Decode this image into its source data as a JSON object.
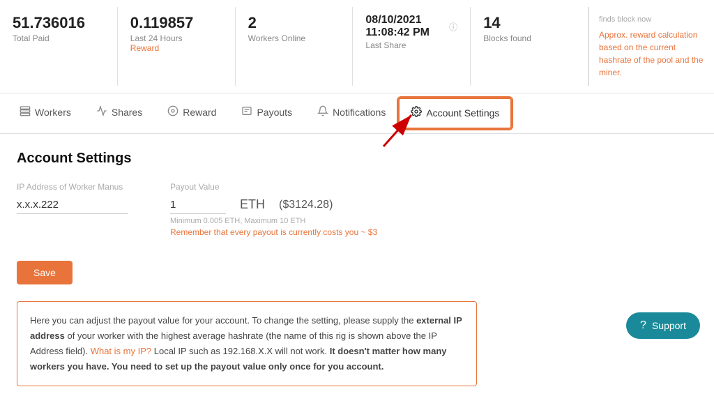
{
  "stats": {
    "totalPaid": {
      "value": "51.736016",
      "label": "Total Paid"
    },
    "last24h": {
      "value": "0.119857",
      "label": "Last 24 Hours",
      "sub": "Reward"
    },
    "workers": {
      "value": "2",
      "label": "Workers Online"
    },
    "lastShare": {
      "value": "08/10/2021 11:08:42 PM",
      "label": "Last Share"
    },
    "blocksFound": {
      "value": "14",
      "label": "Blocks found"
    },
    "sideNote": "Approx. reward calculation based on the current hashrate of the pool and the miner."
  },
  "tabs": [
    {
      "id": "workers",
      "label": "Workers",
      "icon": "⊞"
    },
    {
      "id": "shares",
      "label": "Shares",
      "icon": "↗"
    },
    {
      "id": "reward",
      "label": "Reward",
      "icon": "◎"
    },
    {
      "id": "payouts",
      "label": "Payouts",
      "icon": "📋"
    },
    {
      "id": "notifications",
      "label": "Notifications",
      "icon": "🔔"
    },
    {
      "id": "account-settings",
      "label": "Account Settings",
      "icon": "⚙️",
      "active": true
    }
  ],
  "accountSettings": {
    "title": "Account Settings",
    "ipLabel": "IP Address of Worker Manus",
    "ipValue": "x.x.x.222",
    "payoutLabel": "Payout Value",
    "payoutValue": "1",
    "payoutCurrency": "ETH",
    "payoutUSD": "($3124.28)",
    "payoutMin": "Minimum 0.005 ETH, Maximum 10 ETH",
    "payoutWarn": "Remember that every payout is currently costs you ~ $3",
    "saveLabel": "Save",
    "infoText1": "Here you can adjust the payout value for your account. To change the setting, please supply the ",
    "infoText1Bold": "external IP address",
    "infoText2": " of your worker with the highest average hashrate (the name of this rig is shown above the IP Address field). ",
    "infoLink": "What is my IP?",
    "infoText3": " Local IP such as 192.168.X.X will not work. ",
    "infoText4Bold": "It doesn't matter how many workers you have. You need to set up the payout value only once for you account.",
    "findsBlock": "finds block now"
  },
  "support": {
    "label": "Support"
  }
}
